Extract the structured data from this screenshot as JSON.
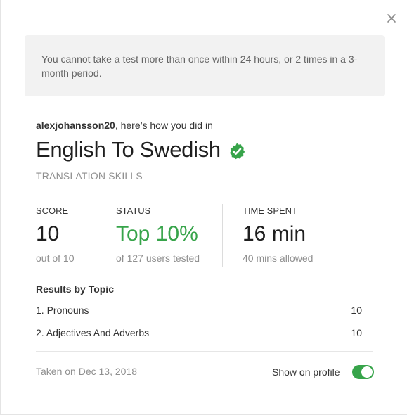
{
  "modal": {
    "close_icon": "close-icon",
    "notice": "You cannot take a test more than once within 24 hours, or 2 times in a 3-month period.",
    "greeting": {
      "username": "alexjohansson20",
      "text": ", here’s how you did in"
    },
    "test_title": "English To Swedish",
    "verified_icon": "check-badge-icon",
    "verified_color": "#37a44a",
    "subtitle": "TRANSLATION SKILLS",
    "stats": {
      "score": {
        "label": "SCORE",
        "value": "10",
        "sub": "out of 10"
      },
      "status": {
        "label": "STATUS",
        "value": "Top 10%",
        "sub": "of 127 users tested",
        "color": "#37a44a"
      },
      "time": {
        "label": "TIME SPENT",
        "value": "16 min",
        "sub": "40 mins allowed"
      }
    },
    "results_title": "Results by Topic",
    "topics": [
      {
        "name": "1. Pronouns",
        "score": "10"
      },
      {
        "name": "2. Adjectives And Adverbs",
        "score": "10"
      }
    ],
    "taken_on": "Taken on Dec 13, 2018",
    "show_on_profile_label": "Show on profile",
    "show_on_profile": true,
    "toggle_color": "#37a44a"
  }
}
